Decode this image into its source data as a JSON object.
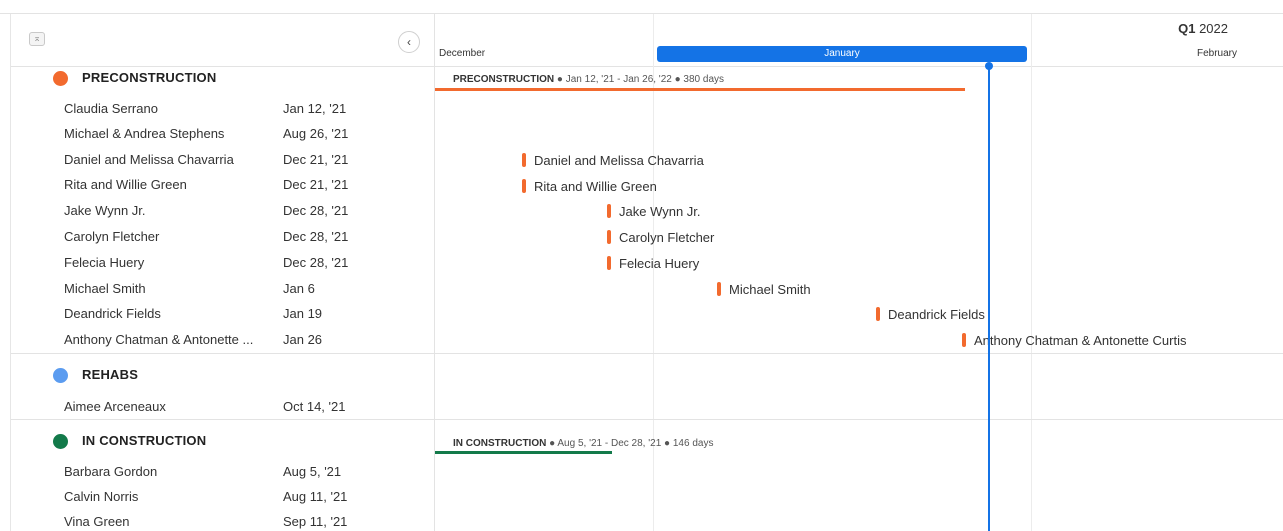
{
  "toolbar": {
    "collapse_icon": "⌅",
    "back_icon": "‹"
  },
  "timeline": {
    "quarter_bold": "Q1",
    "quarter_year": "2022",
    "months": [
      "December",
      "January",
      "February"
    ]
  },
  "groups": [
    {
      "label": "PRECONSTRUCTION",
      "color": "#f26a2e",
      "summary": {
        "name": "PRECONSTRUCTION",
        "detail": "● Jan 12, '21 - Jan 26, '22 ● 380 days"
      },
      "items": [
        {
          "name": "Claudia Serrano",
          "date": "Jan 12, '21"
        },
        {
          "name": "Michael & Andrea Stephens",
          "date": "Aug 26, '21"
        },
        {
          "name": "Daniel and Melissa Chavarria",
          "date": "Dec 21, '21",
          "bar": "Daniel and Melissa Chavarria"
        },
        {
          "name": "Rita and Willie Green",
          "date": "Dec 21, '21",
          "bar": "Rita and Willie Green"
        },
        {
          "name": "Jake Wynn Jr.",
          "date": "Dec 28, '21",
          "bar": "Jake Wynn Jr."
        },
        {
          "name": "Carolyn Fletcher",
          "date": "Dec 28, '21",
          "bar": "Carolyn Fletcher"
        },
        {
          "name": "Felecia Huery",
          "date": "Dec 28, '21",
          "bar": "Felecia Huery"
        },
        {
          "name": "Michael Smith",
          "date": "Jan 6",
          "bar": "Michael Smith"
        },
        {
          "name": "Deandrick Fields",
          "date": "Jan 19",
          "bar": "Deandrick Fields"
        },
        {
          "name": "Anthony Chatman & Antonette ...",
          "date": "Jan 26",
          "bar": "Anthony Chatman & Antonette Curtis"
        }
      ]
    },
    {
      "label": "REHABS",
      "color": "#5b9cf0",
      "items": [
        {
          "name": "Aimee Arceneaux",
          "date": "Oct 14, '21"
        }
      ]
    },
    {
      "label": "IN CONSTRUCTION",
      "color": "#137a4a",
      "summary": {
        "name": "IN CONSTRUCTION",
        "detail": "● Aug 5, '21 - Dec 28, '21 ● 146 days"
      },
      "items": [
        {
          "name": "Barbara Gordon",
          "date": "Aug 5, '21"
        },
        {
          "name": "Calvin Norris",
          "date": "Aug 11, '21"
        },
        {
          "name": "Vina Green",
          "date": "Sep 11, '21"
        }
      ]
    }
  ],
  "colors": {
    "accent": "#1473e6",
    "preconstruction": "#f26a2e",
    "rehabs": "#5b9cf0",
    "in_construction": "#137a4a"
  }
}
